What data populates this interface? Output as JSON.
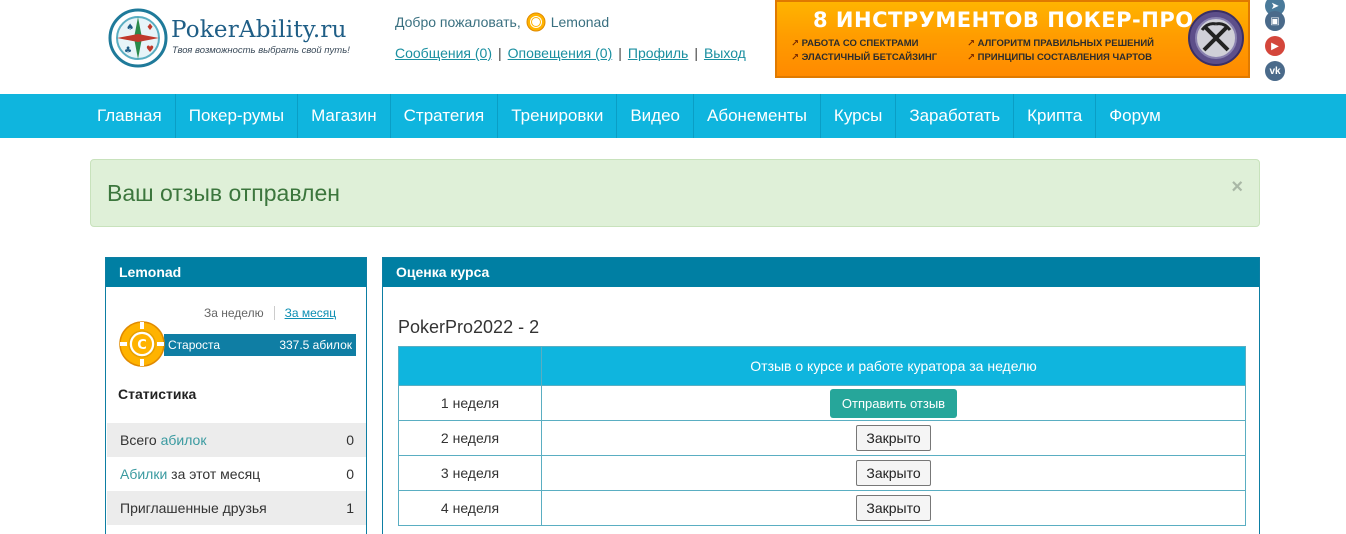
{
  "header": {
    "logo_name": "PokerAbility.ru",
    "logo_tagline": "Твоя возможность выбрать свой путь!",
    "welcome_text": "Добро пожаловать,",
    "username": "Lemonad",
    "user_links": [
      "Сообщения (0)",
      "Оповещения (0)",
      "Профиль",
      "Выход"
    ],
    "banner": {
      "title": "8 ИНСТРУМЕНТОВ ПОКЕР-ПРО",
      "features": [
        "РАБОТА СО СПЕКТРАМИ",
        "ЭЛАСТИЧНЫЙ БЕТСАЙЗИНГ",
        "АЛГОРИТМ ПРАВИЛЬНЫХ РЕШЕНИЙ",
        "ПРИНЦИПЫ СОСТАВЛЕНИЯ ЧАРТОВ"
      ]
    },
    "social": [
      {
        "icon": "telegram-icon",
        "color": "#4a7a9a"
      },
      {
        "icon": "twitch-icon",
        "color": "#4a6a8a"
      },
      {
        "icon": "youtube-icon",
        "color": "#d4463b"
      },
      {
        "icon": "vk-icon",
        "color": "#4a6a8a"
      }
    ]
  },
  "nav": [
    "Главная",
    "Покер-румы",
    "Магазин",
    "Стратегия",
    "Тренировки",
    "Видео",
    "Абонементы",
    "Курсы",
    "Заработать",
    "Крипта",
    "Форум"
  ],
  "alert": {
    "message": "Ваш отзыв отправлен",
    "close": "×"
  },
  "profile": {
    "title": "Lemonad",
    "period_week": "За неделю",
    "period_month": "За месяц",
    "rank_name": "Староста",
    "rank_value": "337.5 абилок",
    "chip_letter": "C",
    "stats_title": "Статистика",
    "stats": [
      {
        "prefix": "Всего ",
        "highlight": "абилок",
        "suffix": "",
        "value": "0"
      },
      {
        "prefix": "",
        "highlight": "Абилки",
        "suffix": " за этот месяц",
        "value": "0"
      },
      {
        "prefix": "Приглашенные друзья",
        "highlight": "",
        "suffix": "",
        "value": "1"
      }
    ]
  },
  "course": {
    "panel_title": "Оценка курса",
    "name": "PokerPro2022 - 2",
    "table_header_week": "",
    "table_header_review": "Отзыв о курсе и работе куратора за неделю",
    "rows": [
      {
        "week": "1 неделя",
        "action": "Отправить отзыв",
        "type": "send"
      },
      {
        "week": "2 неделя",
        "action": "Закрыто",
        "type": "closed"
      },
      {
        "week": "3 неделя",
        "action": "Закрыто",
        "type": "closed"
      },
      {
        "week": "4 неделя",
        "action": "Закрыто",
        "type": "closed"
      }
    ]
  },
  "colors": {
    "nav_bg": "#0fb5de",
    "panel_head": "#007fa3",
    "alert_bg": "#dff0d8",
    "alert_text": "#3c763d",
    "button_send": "#26a69a",
    "banner": "#ff9d00"
  }
}
